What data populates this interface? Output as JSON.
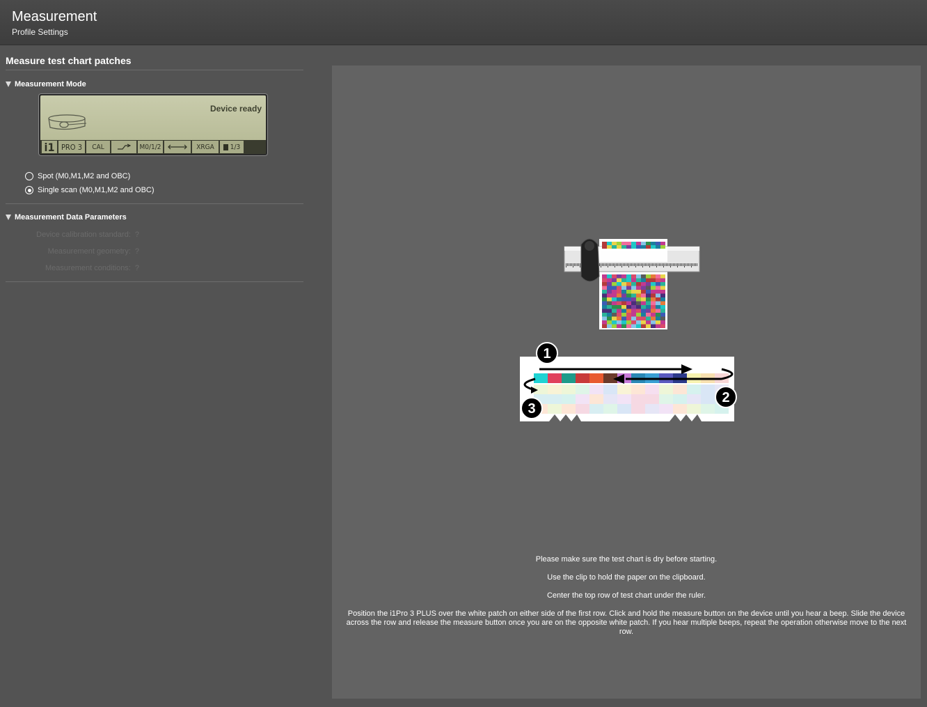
{
  "header": {
    "title": "Measurement",
    "subtitle": "Profile Settings"
  },
  "left": {
    "section_title": "Measure test chart patches",
    "mode": {
      "heading": "Measurement Mode",
      "lcd": {
        "status": "Device ready",
        "cells": [
          "i1",
          "PRO 3",
          "CAL",
          "M0/1/2",
          "XRGA",
          "1/3"
        ]
      },
      "options": [
        {
          "label": "Spot (M0,M1,M2 and OBC)",
          "selected": false
        },
        {
          "label": "Single scan (M0,M1,M2 and OBC)",
          "selected": true
        }
      ]
    },
    "params": {
      "heading": "Measurement Data Parameters",
      "rows": [
        {
          "label": "Device calibration standard:",
          "help": "?"
        },
        {
          "label": "Measurement geometry:",
          "help": "?"
        },
        {
          "label": "Measurement conditions:",
          "help": "?"
        }
      ]
    }
  },
  "instructions": {
    "line1": "Please make sure the test chart is dry before starting.",
    "line2": "Use the clip to hold the paper on the clipboard.",
    "line3": "Center the top row of test chart under the ruler.",
    "line4": "Position the i1Pro 3 PLUS over the white patch on either side of the first row. Click and hold the measure button on the device until you hear a beep. Slide the device across the row and release the measure button once you are on the opposite white patch. If you hear multiple beeps, repeat the operation otherwise move to the next row."
  },
  "illustration": {
    "step_numbers": [
      "1",
      "2",
      "3"
    ]
  },
  "colors": {
    "background": "#535353",
    "panel": "#636363",
    "header": "#404040",
    "lcd": "#c2c5a3"
  }
}
